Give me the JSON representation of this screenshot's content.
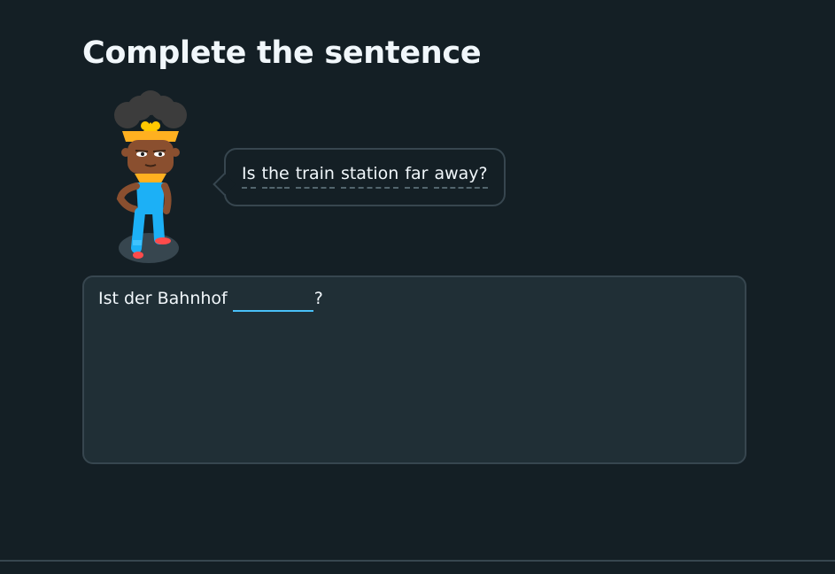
{
  "exercise": {
    "title": "Complete the sentence"
  },
  "prompt": {
    "words": [
      "Is",
      "the",
      "train",
      "station",
      "far",
      "away?"
    ]
  },
  "answer": {
    "before_blank": "Ist der Bahnhof",
    "after_blank": "?",
    "blank_value": ""
  },
  "colors": {
    "background": "#141f25",
    "panel": "#202f36",
    "border": "#37464f",
    "blank_underline": "#49c0f8",
    "text": "#f1f7fb"
  }
}
